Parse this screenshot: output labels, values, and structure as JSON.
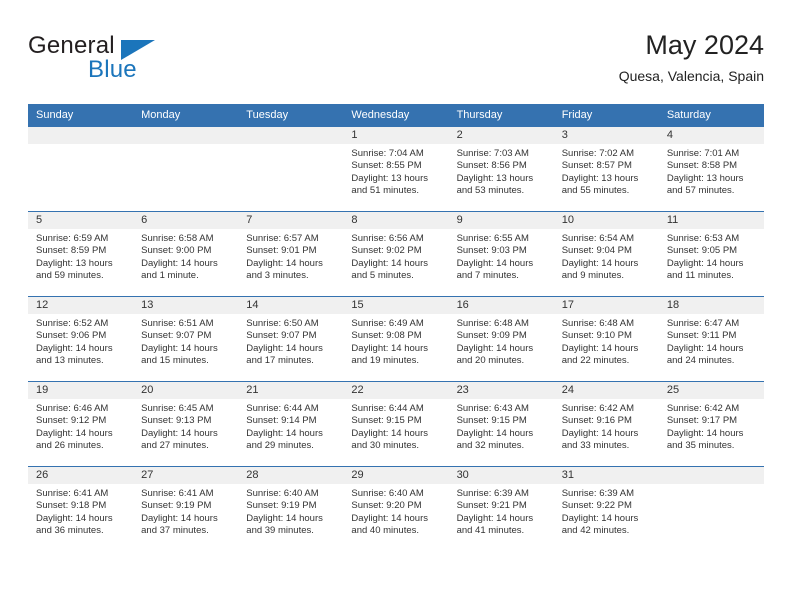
{
  "brand": {
    "name_part1": "General",
    "name_part2": "Blue",
    "triangle_color": "#1b75bb"
  },
  "header": {
    "title": "May 2024",
    "subtitle": "Quesa, Valencia, Spain"
  },
  "colors": {
    "header_blue": "#3572b0",
    "daynum_band": "#f0f0f0",
    "text": "#333333"
  },
  "weekday_headers": [
    "Sunday",
    "Monday",
    "Tuesday",
    "Wednesday",
    "Thursday",
    "Friday",
    "Saturday"
  ],
  "weeks": [
    [
      {
        "day": "",
        "sunrise": "",
        "sunset": "",
        "daylight_line1": "",
        "daylight_line2": ""
      },
      {
        "day": "",
        "sunrise": "",
        "sunset": "",
        "daylight_line1": "",
        "daylight_line2": ""
      },
      {
        "day": "",
        "sunrise": "",
        "sunset": "",
        "daylight_line1": "",
        "daylight_line2": ""
      },
      {
        "day": "1",
        "sunrise": "Sunrise: 7:04 AM",
        "sunset": "Sunset: 8:55 PM",
        "daylight_line1": "Daylight: 13 hours",
        "daylight_line2": "and 51 minutes."
      },
      {
        "day": "2",
        "sunrise": "Sunrise: 7:03 AM",
        "sunset": "Sunset: 8:56 PM",
        "daylight_line1": "Daylight: 13 hours",
        "daylight_line2": "and 53 minutes."
      },
      {
        "day": "3",
        "sunrise": "Sunrise: 7:02 AM",
        "sunset": "Sunset: 8:57 PM",
        "daylight_line1": "Daylight: 13 hours",
        "daylight_line2": "and 55 minutes."
      },
      {
        "day": "4",
        "sunrise": "Sunrise: 7:01 AM",
        "sunset": "Sunset: 8:58 PM",
        "daylight_line1": "Daylight: 13 hours",
        "daylight_line2": "and 57 minutes."
      }
    ],
    [
      {
        "day": "5",
        "sunrise": "Sunrise: 6:59 AM",
        "sunset": "Sunset: 8:59 PM",
        "daylight_line1": "Daylight: 13 hours",
        "daylight_line2": "and 59 minutes."
      },
      {
        "day": "6",
        "sunrise": "Sunrise: 6:58 AM",
        "sunset": "Sunset: 9:00 PM",
        "daylight_line1": "Daylight: 14 hours",
        "daylight_line2": "and 1 minute."
      },
      {
        "day": "7",
        "sunrise": "Sunrise: 6:57 AM",
        "sunset": "Sunset: 9:01 PM",
        "daylight_line1": "Daylight: 14 hours",
        "daylight_line2": "and 3 minutes."
      },
      {
        "day": "8",
        "sunrise": "Sunrise: 6:56 AM",
        "sunset": "Sunset: 9:02 PM",
        "daylight_line1": "Daylight: 14 hours",
        "daylight_line2": "and 5 minutes."
      },
      {
        "day": "9",
        "sunrise": "Sunrise: 6:55 AM",
        "sunset": "Sunset: 9:03 PM",
        "daylight_line1": "Daylight: 14 hours",
        "daylight_line2": "and 7 minutes."
      },
      {
        "day": "10",
        "sunrise": "Sunrise: 6:54 AM",
        "sunset": "Sunset: 9:04 PM",
        "daylight_line1": "Daylight: 14 hours",
        "daylight_line2": "and 9 minutes."
      },
      {
        "day": "11",
        "sunrise": "Sunrise: 6:53 AM",
        "sunset": "Sunset: 9:05 PM",
        "daylight_line1": "Daylight: 14 hours",
        "daylight_line2": "and 11 minutes."
      }
    ],
    [
      {
        "day": "12",
        "sunrise": "Sunrise: 6:52 AM",
        "sunset": "Sunset: 9:06 PM",
        "daylight_line1": "Daylight: 14 hours",
        "daylight_line2": "and 13 minutes."
      },
      {
        "day": "13",
        "sunrise": "Sunrise: 6:51 AM",
        "sunset": "Sunset: 9:07 PM",
        "daylight_line1": "Daylight: 14 hours",
        "daylight_line2": "and 15 minutes."
      },
      {
        "day": "14",
        "sunrise": "Sunrise: 6:50 AM",
        "sunset": "Sunset: 9:07 PM",
        "daylight_line1": "Daylight: 14 hours",
        "daylight_line2": "and 17 minutes."
      },
      {
        "day": "15",
        "sunrise": "Sunrise: 6:49 AM",
        "sunset": "Sunset: 9:08 PM",
        "daylight_line1": "Daylight: 14 hours",
        "daylight_line2": "and 19 minutes."
      },
      {
        "day": "16",
        "sunrise": "Sunrise: 6:48 AM",
        "sunset": "Sunset: 9:09 PM",
        "daylight_line1": "Daylight: 14 hours",
        "daylight_line2": "and 20 minutes."
      },
      {
        "day": "17",
        "sunrise": "Sunrise: 6:48 AM",
        "sunset": "Sunset: 9:10 PM",
        "daylight_line1": "Daylight: 14 hours",
        "daylight_line2": "and 22 minutes."
      },
      {
        "day": "18",
        "sunrise": "Sunrise: 6:47 AM",
        "sunset": "Sunset: 9:11 PM",
        "daylight_line1": "Daylight: 14 hours",
        "daylight_line2": "and 24 minutes."
      }
    ],
    [
      {
        "day": "19",
        "sunrise": "Sunrise: 6:46 AM",
        "sunset": "Sunset: 9:12 PM",
        "daylight_line1": "Daylight: 14 hours",
        "daylight_line2": "and 26 minutes."
      },
      {
        "day": "20",
        "sunrise": "Sunrise: 6:45 AM",
        "sunset": "Sunset: 9:13 PM",
        "daylight_line1": "Daylight: 14 hours",
        "daylight_line2": "and 27 minutes."
      },
      {
        "day": "21",
        "sunrise": "Sunrise: 6:44 AM",
        "sunset": "Sunset: 9:14 PM",
        "daylight_line1": "Daylight: 14 hours",
        "daylight_line2": "and 29 minutes."
      },
      {
        "day": "22",
        "sunrise": "Sunrise: 6:44 AM",
        "sunset": "Sunset: 9:15 PM",
        "daylight_line1": "Daylight: 14 hours",
        "daylight_line2": "and 30 minutes."
      },
      {
        "day": "23",
        "sunrise": "Sunrise: 6:43 AM",
        "sunset": "Sunset: 9:15 PM",
        "daylight_line1": "Daylight: 14 hours",
        "daylight_line2": "and 32 minutes."
      },
      {
        "day": "24",
        "sunrise": "Sunrise: 6:42 AM",
        "sunset": "Sunset: 9:16 PM",
        "daylight_line1": "Daylight: 14 hours",
        "daylight_line2": "and 33 minutes."
      },
      {
        "day": "25",
        "sunrise": "Sunrise: 6:42 AM",
        "sunset": "Sunset: 9:17 PM",
        "daylight_line1": "Daylight: 14 hours",
        "daylight_line2": "and 35 minutes."
      }
    ],
    [
      {
        "day": "26",
        "sunrise": "Sunrise: 6:41 AM",
        "sunset": "Sunset: 9:18 PM",
        "daylight_line1": "Daylight: 14 hours",
        "daylight_line2": "and 36 minutes."
      },
      {
        "day": "27",
        "sunrise": "Sunrise: 6:41 AM",
        "sunset": "Sunset: 9:19 PM",
        "daylight_line1": "Daylight: 14 hours",
        "daylight_line2": "and 37 minutes."
      },
      {
        "day": "28",
        "sunrise": "Sunrise: 6:40 AM",
        "sunset": "Sunset: 9:19 PM",
        "daylight_line1": "Daylight: 14 hours",
        "daylight_line2": "and 39 minutes."
      },
      {
        "day": "29",
        "sunrise": "Sunrise: 6:40 AM",
        "sunset": "Sunset: 9:20 PM",
        "daylight_line1": "Daylight: 14 hours",
        "daylight_line2": "and 40 minutes."
      },
      {
        "day": "30",
        "sunrise": "Sunrise: 6:39 AM",
        "sunset": "Sunset: 9:21 PM",
        "daylight_line1": "Daylight: 14 hours",
        "daylight_line2": "and 41 minutes."
      },
      {
        "day": "31",
        "sunrise": "Sunrise: 6:39 AM",
        "sunset": "Sunset: 9:22 PM",
        "daylight_line1": "Daylight: 14 hours",
        "daylight_line2": "and 42 minutes."
      },
      {
        "day": "",
        "sunrise": "",
        "sunset": "",
        "daylight_line1": "",
        "daylight_line2": ""
      }
    ]
  ]
}
